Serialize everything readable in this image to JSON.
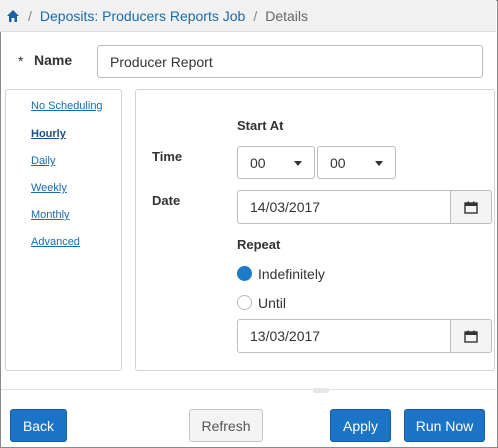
{
  "breadcrumb": {
    "parent": "Deposits: Producers Reports Job",
    "current": "Details"
  },
  "name": {
    "required_marker": "*",
    "label": "Name",
    "value": "Producer Report"
  },
  "schedule": {
    "items": [
      {
        "label": "No Scheduling",
        "active": false
      },
      {
        "label": "Hourly",
        "active": true
      },
      {
        "label": "Daily",
        "active": false
      },
      {
        "label": "Weekly",
        "active": false
      },
      {
        "label": "Monthly",
        "active": false
      },
      {
        "label": "Advanced",
        "active": false
      }
    ]
  },
  "start": {
    "heading": "Start At",
    "time_label": "Time",
    "hour": "00",
    "minute": "00",
    "date_label": "Date",
    "date": "14/03/2017"
  },
  "repeat": {
    "heading": "Repeat",
    "option_indefinitely": "Indefinitely",
    "option_until": "Until",
    "selected": "Indefinitely",
    "until_date": "13/03/2017"
  },
  "footer": {
    "back": "Back",
    "refresh": "Refresh",
    "apply": "Apply",
    "run_now": "Run Now"
  },
  "colors": {
    "primary": "#1b74c5",
    "link": "#1b6aaa"
  }
}
